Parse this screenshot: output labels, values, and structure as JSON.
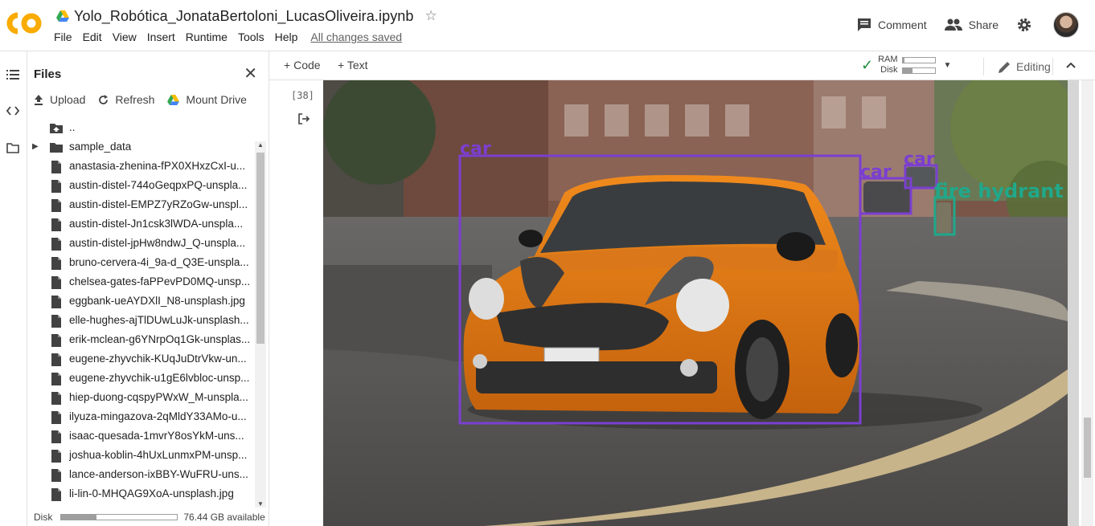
{
  "header": {
    "doc_title": "Yolo_Robótica_JonataBertoloni_LucasOliveira.ipynb",
    "menu": [
      "File",
      "Edit",
      "View",
      "Insert",
      "Runtime",
      "Tools",
      "Help"
    ],
    "save_status": "All changes saved",
    "comment_label": "Comment",
    "share_label": "Share",
    "logo_text": "CO"
  },
  "files_panel": {
    "title": "Files",
    "upload_label": "Upload",
    "refresh_label": "Refresh",
    "mount_label": "Mount Drive",
    "items": [
      {
        "name": "..",
        "type": "parent"
      },
      {
        "name": "sample_data",
        "type": "folder"
      },
      {
        "name": "anastasia-zhenina-fPX0XHxzCxI-u...",
        "type": "file"
      },
      {
        "name": "austin-distel-744oGeqpxPQ-unspla...",
        "type": "file"
      },
      {
        "name": "austin-distel-EMPZ7yRZoGw-unspl...",
        "type": "file"
      },
      {
        "name": "austin-distel-Jn1csk3lWDA-unspla...",
        "type": "file"
      },
      {
        "name": "austin-distel-jpHw8ndwJ_Q-unspla...",
        "type": "file"
      },
      {
        "name": "bruno-cervera-4i_9a-d_Q3E-unspla...",
        "type": "file"
      },
      {
        "name": "chelsea-gates-faPPevPD0MQ-unsp...",
        "type": "file"
      },
      {
        "name": "eggbank-ueAYDXlI_N8-unsplash.jpg",
        "type": "file"
      },
      {
        "name": "elle-hughes-ajTlDUwLuJk-unsplash...",
        "type": "file"
      },
      {
        "name": "erik-mclean-g6YNrpOq1Gk-unsplas...",
        "type": "file"
      },
      {
        "name": "eugene-zhyvchik-KUqJuDtrVkw-un...",
        "type": "file"
      },
      {
        "name": "eugene-zhyvchik-u1gE6lvbloc-unsp...",
        "type": "file"
      },
      {
        "name": "hiep-duong-cqspyPWxW_M-unspla...",
        "type": "file"
      },
      {
        "name": "ilyuza-mingazova-2qMldY33AMo-u...",
        "type": "file"
      },
      {
        "name": "isaac-quesada-1mvrY8osYkM-uns...",
        "type": "file"
      },
      {
        "name": "joshua-koblin-4hUxLunmxPM-unsp...",
        "type": "file"
      },
      {
        "name": "lance-anderson-ixBBY-WuFRU-uns...",
        "type": "file"
      },
      {
        "name": "li-lin-0-MHQAG9XoA-unsplash.jpg",
        "type": "file"
      }
    ],
    "disk_label": "Disk",
    "disk_available": "76.44 GB available",
    "disk_used_fraction": 0.3
  },
  "notebook_toolbar": {
    "code_label": "Code",
    "text_label": "Text",
    "ram_label": "RAM",
    "disk_label": "Disk",
    "ram_fraction": 0.05,
    "disk_fraction": 0.3,
    "editing_label": "Editing"
  },
  "cell": {
    "exec_count": "[38]",
    "detections": [
      {
        "label": "car",
        "color": "#7b3fd0"
      },
      {
        "label": "car",
        "color": "#7b3fd0"
      },
      {
        "label": "car",
        "color": "#7b3fd0"
      },
      {
        "label": "fire hydrant",
        "color": "#20a88a"
      }
    ]
  },
  "colors": {
    "accent": "#1e8e3e",
    "logo_orange": "#f9ab00",
    "car_box": "#7b3fd0",
    "hydrant_box": "#20a88a"
  }
}
